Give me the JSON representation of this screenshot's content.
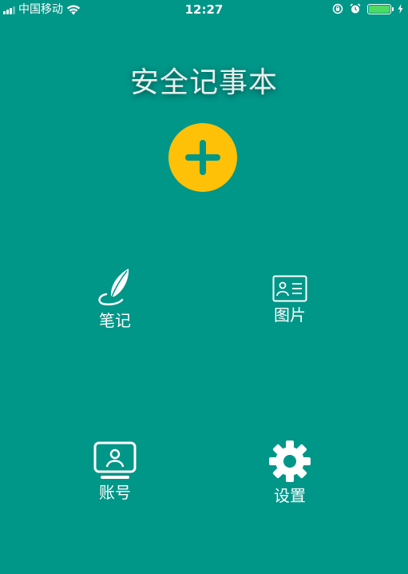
{
  "status_bar": {
    "carrier": "中国移动",
    "time": "12:27",
    "icons": [
      "signal-icon",
      "wifi-icon",
      "lock-rotation-icon",
      "alarm-icon",
      "battery-icon",
      "charging-icon"
    ],
    "battery_color": "#4cd964"
  },
  "header": {
    "title": "安全记事本"
  },
  "add_button": {
    "icon": "plus-icon",
    "color": "#ffc107",
    "icon_color": "#009688"
  },
  "menu": {
    "items": [
      {
        "label": "笔记",
        "icon": "feather-icon"
      },
      {
        "label": "图片",
        "icon": "id-card-icon"
      },
      {
        "label": "账号",
        "icon": "account-monitor-icon"
      },
      {
        "label": "设置",
        "icon": "gear-icon"
      }
    ]
  },
  "colors": {
    "background": "#009688",
    "text": "#ffffff",
    "title_text": "#e6f0ee"
  }
}
